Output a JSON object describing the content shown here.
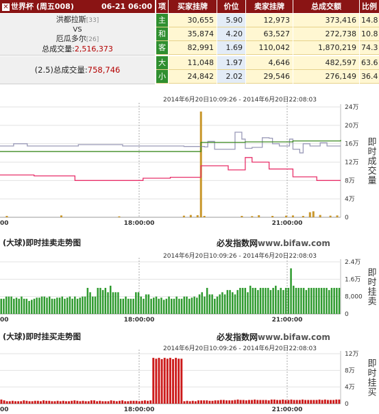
{
  "header": {
    "tournament": "世界杯 (周五008)",
    "datetime": "06-21 06:00",
    "col_item": "项",
    "col_buy": "买家挂牌",
    "col_price": "价位",
    "col_sell": "卖家挂牌",
    "col_total": "总成交额",
    "col_ratio": "比例"
  },
  "match": {
    "home": "洪都拉斯",
    "home_rank": "[33]",
    "vs": "VS",
    "away": "厄瓜多尔",
    "away_rank": "[26]",
    "total_label": "总成交量:",
    "total_value": "2,516,373",
    "ou_label": "(2.5)总成交量:",
    "ou_value": "758,746"
  },
  "rows": [
    {
      "item": "主",
      "buy": "30,655",
      "price": "5.90",
      "sell": "12,973",
      "total": "373,416",
      "ratio": "14.8"
    },
    {
      "item": "和",
      "buy": "35,874",
      "price": "4.20",
      "sell": "63,527",
      "total": "272,738",
      "ratio": "10.8"
    },
    {
      "item": "客",
      "buy": "82,991",
      "price": "1.69",
      "sell": "110,042",
      "total": "1,870,219",
      "ratio": "74.3"
    },
    {
      "item": "大",
      "buy": "11,048",
      "price": "1.97",
      "sell": "4,646",
      "total": "482,597",
      "ratio": "63.6"
    },
    {
      "item": "小",
      "buy": "24,842",
      "price": "2.02",
      "sell": "29,546",
      "total": "276,149",
      "ratio": "36.4"
    }
  ],
  "colors": {
    "header_bg": "#8a1414",
    "item_bg": "#2f8f2f",
    "buy_bg": "#fff7d2",
    "price_bg": "#e3ecf7",
    "line_red": "#e8306a",
    "line_green": "#3d8a22",
    "line_gray": "#9a9ab8",
    "vol_bar": "#c8962a",
    "sell_bar": "#2e9a2e",
    "buy_bar": "#cc1a1a"
  },
  "charts": {
    "range": "2014年6月20日10:09:26 - 2014年6月20日22:08:03",
    "site": "必发指数网",
    "site_url": "www.bifaw.com",
    "sell_title": "(大球)即时挂卖走势图",
    "buy_title": "(大球)即时挂买走势图"
  },
  "chart_data": [
    {
      "type": "line",
      "ylabel": "即时成交量",
      "y_ticks": [
        "0",
        "4万",
        "8万",
        "12万",
        "16万",
        "20万",
        "24万"
      ],
      "y_tick_values": [
        0,
        40000,
        80000,
        120000,
        160000,
        200000,
        240000
      ],
      "ylim": [
        0,
        240000
      ],
      "x_ticks": [
        "00",
        "18:00:00",
        "21:00:00"
      ],
      "xlim": [
        0,
        100
      ],
      "series": [
        {
          "name": "",
          "values": [
            [
              0,
              155000
            ],
            [
              4,
              160000
            ],
            [
              6,
              160000
            ],
            [
              8,
              155000
            ],
            [
              18,
              155000
            ],
            [
              23,
              158000
            ],
            [
              30,
              158000
            ],
            [
              36,
              155000
            ],
            [
              42,
              155000
            ],
            [
              48,
              155000
            ],
            [
              54,
              154000
            ],
            [
              60,
              153000
            ],
            [
              61,
              165000
            ],
            [
              63,
              148000
            ],
            [
              67,
              148000
            ],
            [
              69,
              185000
            ],
            [
              71,
              170000
            ],
            [
              72,
              150000
            ],
            [
              74,
              152000
            ],
            [
              77,
              173000
            ],
            [
              79,
              172000
            ],
            [
              80,
              160000
            ],
            [
              82,
              155000
            ],
            [
              84,
              155000
            ],
            [
              85,
              170000
            ],
            [
              86,
              148000
            ],
            [
              88,
              140000
            ],
            [
              89,
              160000
            ],
            [
              91,
              155000
            ],
            [
              93,
              155000
            ],
            [
              94,
              162000
            ],
            [
              96,
              155000
            ],
            [
              100,
              155000
            ]
          ]
        },
        {
          "name": "",
          "values": [
            [
              0,
              143000
            ],
            [
              14,
              143000
            ],
            [
              30,
              143000
            ],
            [
              46,
              143000
            ],
            [
              58,
              143000
            ],
            [
              59,
              163000
            ],
            [
              72,
              164000
            ],
            [
              86,
              166000
            ],
            [
              100,
              168000
            ]
          ]
        },
        {
          "name": "",
          "values": [
            [
              0,
              92000
            ],
            [
              10,
              90000
            ],
            [
              22,
              80000
            ],
            [
              34,
              80000
            ],
            [
              42,
              85000
            ],
            [
              50,
              87000
            ],
            [
              58,
              87000
            ],
            [
              59,
              112000
            ],
            [
              65,
              112000
            ],
            [
              67,
              103000
            ],
            [
              71,
              103000
            ],
            [
              72,
              130000
            ],
            [
              74,
              120000
            ],
            [
              78,
              120000
            ],
            [
              79,
              105000
            ],
            [
              85,
              105000
            ],
            [
              86,
              88000
            ],
            [
              92,
              88000
            ],
            [
              93,
              80000
            ],
            [
              100,
              80000
            ]
          ]
        }
      ],
      "volume_bars": [
        [
          2,
          3000
        ],
        [
          18,
          4000
        ],
        [
          35,
          2000
        ],
        [
          54,
          3500
        ],
        [
          56,
          5000
        ],
        [
          58,
          4500
        ],
        [
          59,
          230000
        ],
        [
          60,
          3000
        ],
        [
          71,
          3000
        ],
        [
          74,
          2500
        ],
        [
          76,
          4500
        ],
        [
          80,
          3000
        ],
        [
          84,
          3500
        ],
        [
          86,
          4000
        ],
        [
          89,
          3000
        ],
        [
          91,
          11000
        ],
        [
          92,
          13000
        ],
        [
          94,
          5000
        ],
        [
          97,
          3500
        ],
        [
          99,
          4000
        ]
      ]
    },
    {
      "type": "bar",
      "ylabel": "即时挂卖",
      "y_ticks": [
        "0",
        "8,000",
        "1.6万",
        "2.4万"
      ],
      "y_tick_values": [
        0,
        8000,
        16000,
        24000
      ],
      "ylim": [
        0,
        24000
      ],
      "x_ticks": [
        "00",
        "18:00:00",
        "21:00:00"
      ],
      "values": [
        7000,
        7000,
        8000,
        8000,
        8000,
        7000,
        7500,
        7000,
        8000,
        7000,
        7000,
        6000,
        6500,
        7000,
        7500,
        7500,
        8000,
        8000,
        7500,
        8000,
        7000,
        7000,
        7500,
        7500,
        8000,
        7000,
        7500,
        8000,
        7000,
        8000,
        7000,
        7500,
        8000,
        8000,
        12000,
        10000,
        8000,
        8000,
        12000,
        12000,
        11000,
        12000,
        10000,
        13000,
        10000,
        10000,
        10000,
        7000,
        7000,
        8000,
        7000,
        7000,
        7000,
        10000,
        10000,
        8000,
        7000,
        9000,
        9000,
        7000,
        7500,
        8000,
        7000,
        7500,
        6500,
        7000,
        8000,
        7000,
        7000,
        8000,
        7000,
        7000,
        8000,
        8000,
        7000,
        7500,
        8000,
        7500,
        9000,
        10000,
        8000,
        12000,
        9000,
        9000,
        7000,
        8000,
        9000,
        10000,
        9000,
        11000,
        11000,
        10000,
        9000,
        11000,
        12000,
        12000,
        12000,
        10000,
        13000,
        12000,
        12000,
        11000,
        12000,
        12000,
        12000,
        12000,
        11000,
        12000,
        13000,
        11000,
        12000,
        11000,
        12000,
        12000,
        21000,
        13000,
        12000,
        12000,
        12000,
        12000,
        11000,
        12000,
        12000,
        12000,
        12000,
        12000,
        12000,
        12000,
        12000,
        11000,
        12000,
        12000,
        12000,
        12000
      ]
    },
    {
      "type": "bar",
      "ylabel": "即时挂买",
      "y_ticks": [
        "0",
        "4万",
        "8万",
        "12万"
      ],
      "y_tick_values": [
        0,
        40000,
        80000,
        120000
      ],
      "ylim": [
        0,
        120000
      ],
      "x_ticks": [
        "00",
        "18:00:00",
        "21:00:00"
      ],
      "values": [
        10000,
        8000,
        6000,
        6000,
        7000,
        6000,
        6000,
        6000,
        8000,
        7000,
        6000,
        6000,
        7000,
        7000,
        6000,
        8000,
        7000,
        7000,
        6000,
        6000,
        7000,
        6000,
        7000,
        6000,
        6000,
        7000,
        8000,
        7000,
        6000,
        7000,
        6000,
        6000,
        8000,
        8000,
        6000,
        7000,
        6000,
        6000,
        6000,
        8000,
        7000,
        6000,
        7000,
        8000,
        6000,
        6000,
        7000,
        7000,
        7000,
        6000,
        7000,
        8000,
        7000,
        8000,
        110000,
        108000,
        110000,
        107000,
        110000,
        108000,
        110000,
        107000,
        110000,
        108000,
        108000,
        6000,
        7000,
        6000,
        7000,
        6000,
        8000,
        8000,
        8000,
        8000,
        7000,
        7000,
        8000,
        8000,
        9000,
        9000,
        8000,
        8000,
        8000,
        9000,
        10000,
        9000,
        9000,
        8000,
        9000,
        9000,
        10000,
        9000,
        9000,
        9000,
        9000,
        8000,
        10000,
        10000,
        9000,
        9000,
        10000,
        9000,
        9000,
        10000,
        9000,
        9000,
        9000,
        10000,
        9000,
        9000,
        9000,
        9000,
        9000,
        10000,
        9000,
        10000,
        9000,
        9000,
        9000,
        10000,
        10000
      ]
    }
  ]
}
